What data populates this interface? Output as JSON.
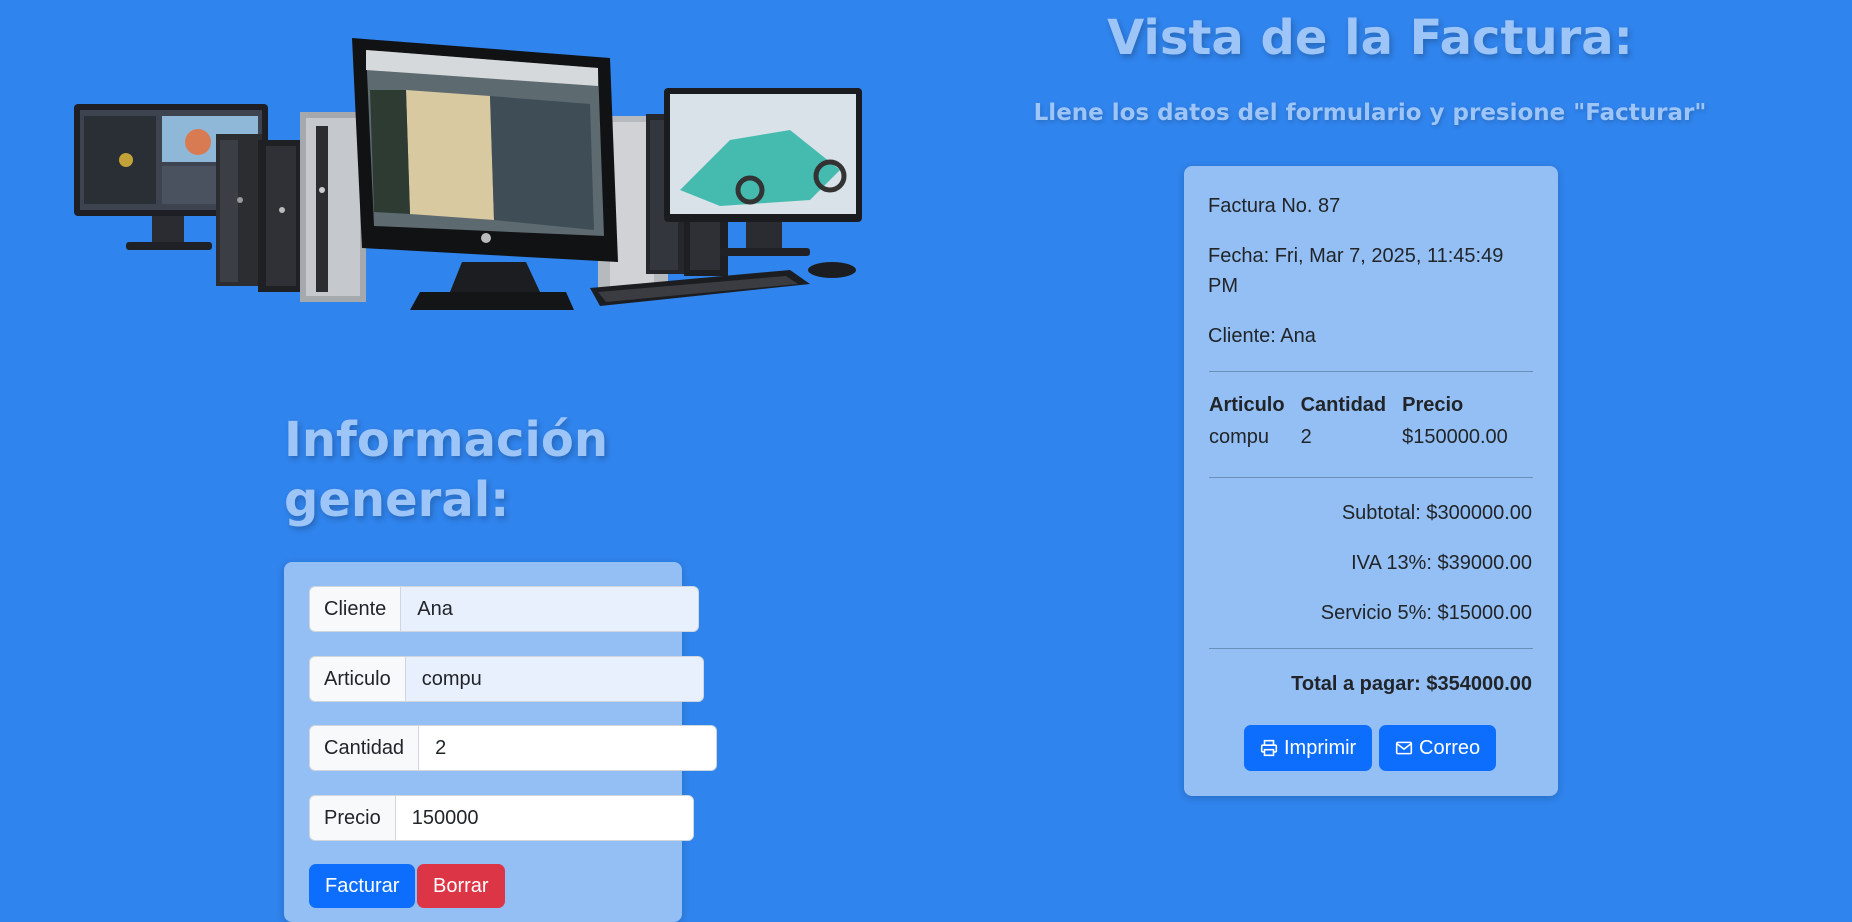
{
  "left": {
    "title": "Información general:"
  },
  "form": {
    "fields": [
      {
        "label": "Cliente",
        "value": "Ana"
      },
      {
        "label": "Articulo",
        "value": "compu"
      },
      {
        "label": "Cantidad",
        "value": "2"
      },
      {
        "label": "Precio",
        "value": "150000"
      }
    ],
    "buttons": {
      "submit": "Facturar",
      "clear": "Borrar"
    }
  },
  "invoice": {
    "title": "Vista de la Factura:",
    "subtitle": "Llene los datos del formulario y presione \"Facturar\"",
    "number": "Factura No. 87",
    "date_line1": "Fecha: Fri, Mar 7, 2025, 11:45:49",
    "date_line2": "PM",
    "client": "Cliente: Ana",
    "table": {
      "headers": [
        "Articulo",
        "Cantidad",
        "Precio"
      ],
      "rows": [
        [
          "compu",
          "2",
          "$150000.00"
        ]
      ]
    },
    "subtotal": "Subtotal: $300000.00",
    "iva": "IVA 13%: $39000.00",
    "service": "Servicio 5%: $15000.00",
    "total": "Total a pagar: $354000.00",
    "buttons": {
      "print": "Imprimir",
      "email": "Correo"
    }
  },
  "icons": {
    "print": "printer-icon",
    "email": "envelope-icon"
  },
  "colors": {
    "background": "#3084ed",
    "card": "#94bff4",
    "title": "#9ec5f8",
    "primary_button": "#0d6efd",
    "danger_button": "#dc3545"
  }
}
